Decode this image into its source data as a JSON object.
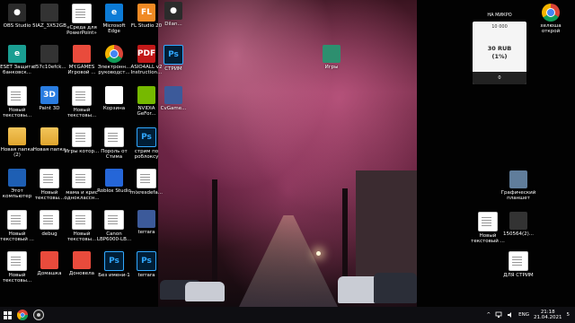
{
  "desktop_icons": [
    {
      "id": "obs",
      "label": "OBS Studio",
      "kind": "obs"
    },
    {
      "id": "5iaz",
      "label": "5IAZ_3X52GB",
      "kind": "dark"
    },
    {
      "id": "sreda",
      "label": "«Среда для PowerPoint»",
      "kind": "file"
    },
    {
      "id": "edge",
      "label": "Microsoft Edge",
      "kind": "edge"
    },
    {
      "id": "fl",
      "label": "FL Studio 20",
      "kind": "fl"
    },
    {
      "id": "eset",
      "label": "ESET Защита банковск...",
      "kind": "eset"
    },
    {
      "id": "d57c",
      "label": "d57c10efck...",
      "kind": "dark"
    },
    {
      "id": "mygames",
      "label": "MY.GAMES Игровой ...",
      "kind": "mygames"
    },
    {
      "id": "electron",
      "label": "Электронн... руководст...",
      "kind": "chrome"
    },
    {
      "id": "asio",
      "label": "ASIO4ALL v2 Instruction...",
      "kind": "pdf"
    },
    {
      "id": "new1",
      "label": "Новый текстовы...",
      "kind": "file"
    },
    {
      "id": "paint3d",
      "label": "Paint 3D",
      "kind": "paint3d"
    },
    {
      "id": "new2",
      "label": "Новый текстовы...",
      "kind": "file"
    },
    {
      "id": "trash",
      "label": "Корзина",
      "kind": "trash"
    },
    {
      "id": "nvidia",
      "label": "NVIDIA GeFor...",
      "kind": "nvidia"
    },
    {
      "id": "folder1",
      "label": "Новая папка (2)",
      "kind": "folder"
    },
    {
      "id": "folder2",
      "label": "Новая папка",
      "kind": "folder"
    },
    {
      "id": "games",
      "label": "Игры котор...",
      "kind": "file"
    },
    {
      "id": "steam",
      "label": "Пороль от Стима",
      "kind": "file"
    },
    {
      "id": "roblox_ps",
      "label": "стрим по роблоксу",
      "kind": "ps"
    },
    {
      "id": "pc",
      "label": "Этот компьютер",
      "kind": "pc"
    },
    {
      "id": "new3",
      "label": "Новый текстовы...",
      "kind": "file"
    },
    {
      "id": "mama",
      "label": "мама и крис одноклассн...",
      "kind": "file"
    },
    {
      "id": "roblox",
      "label": "Roblox Studio",
      "kind": "roblox"
    },
    {
      "id": "mixres",
      "label": "mixresdefa...",
      "kind": "file"
    },
    {
      "id": "new4",
      "label": "Новый текстовый ...",
      "kind": "file"
    },
    {
      "id": "debug",
      "label": "debug",
      "kind": "file"
    },
    {
      "id": "new5",
      "label": "Новый текстовы...",
      "kind": "file"
    },
    {
      "id": "canon",
      "label": "Canon LBP6000-LB...",
      "kind": "file"
    },
    {
      "id": "terrara1",
      "label": "terrara",
      "kind": "img"
    },
    {
      "id": "new6",
      "label": "Новый текстовы...",
      "kind": "file"
    },
    {
      "id": "domashka",
      "label": "Домашка",
      "kind": "mygames"
    },
    {
      "id": "donovela",
      "label": "Доновела",
      "kind": "mygames"
    },
    {
      "id": "bez",
      "label": "Без имени-1",
      "kind": "ps"
    },
    {
      "id": "terrara2",
      "label": "terrara",
      "kind": "ps"
    },
    {
      "id": "dilan",
      "label": "Dilan...",
      "kind": "obs"
    },
    {
      "id": "stream",
      "label": "СТРИМ",
      "kind": "ps"
    },
    {
      "id": "cvgame",
      "label": "CvGame...",
      "kind": "img"
    },
    {
      "id": "igry",
      "label": "Игры",
      "kind": "book"
    },
    {
      "id": "chrome_r",
      "label": "хелюша открой",
      "kind": "chrome"
    },
    {
      "id": "graph",
      "label": "Графический планшет",
      "kind": "tablet"
    },
    {
      "id": "new7",
      "label": "Новый текстовый ...",
      "kind": "file"
    },
    {
      "id": "num",
      "label": "150564(2)...",
      "kind": "dark"
    },
    {
      "id": "dlya",
      "label": "ДЛЯ СТРИМ",
      "kind": "file"
    }
  ],
  "widget": {
    "header": "НА МИКРО",
    "top": "10 000",
    "mid": "30 RUB\n(1%)",
    "bottom": "0"
  },
  "taskbar": {
    "lang": "ENG",
    "time": "21:18",
    "date": "21.04.2021",
    "notif": "5"
  },
  "colors": {
    "taskbar": "#0e0e12",
    "ps": "#31a8ff"
  }
}
